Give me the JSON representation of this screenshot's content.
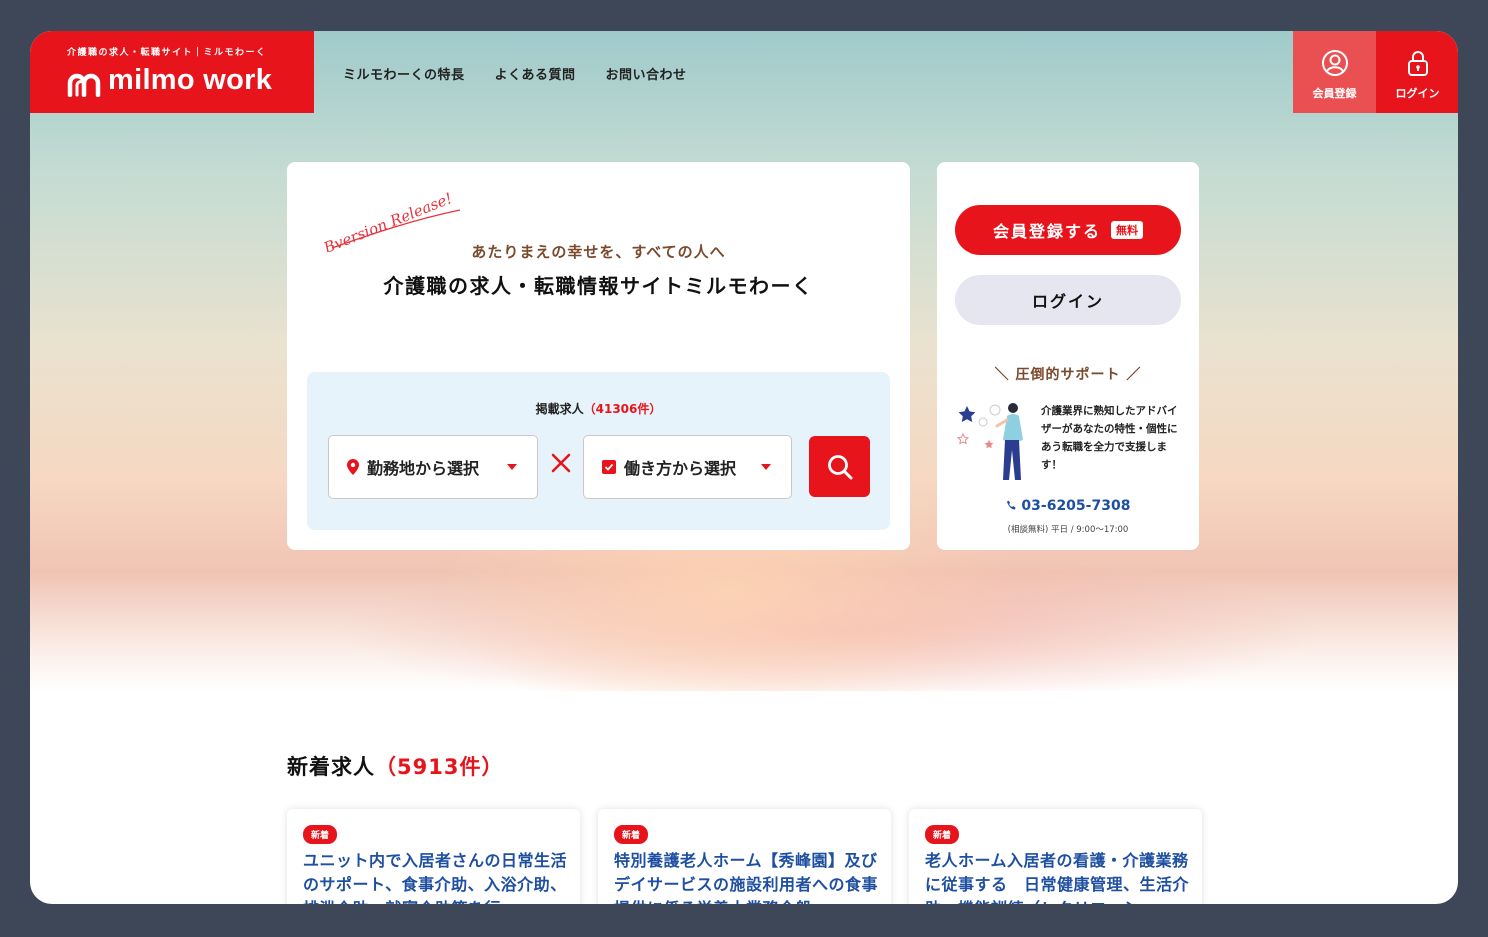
{
  "header": {
    "logo_tagline": "介護職の求人・転職サイト｜ミルモわーく",
    "logo_text": "milmo work",
    "nav": [
      {
        "label": "ミルモわーくの特長"
      },
      {
        "label": "よくある質問"
      },
      {
        "label": "お問い合わせ"
      }
    ],
    "register_label": "会員登録",
    "login_label": "ログイン"
  },
  "hero": {
    "release_badge": "Bversion Release!",
    "tagline": "あたりまえの幸せを、すべての人へ",
    "title": "介護職の求人・転職情報サイトミルモわーく",
    "listing_label": "掲載求人",
    "listing_count": "（41306件）",
    "area_select": "勤務地から選択",
    "work_select": "働き方から選択"
  },
  "side": {
    "register_button": "会員登録する",
    "free_badge": "無料",
    "login_button": "ログイン",
    "support_title": "＼ 圧倒的サポート ／",
    "support_text": "介護業界に熟知したアドバイザーがあなたの特性・個性にあう転職を全力で支援します！",
    "phone": "03-6205-7308",
    "hours": "(相談無料) 平日 / 9:00〜17:00"
  },
  "new_jobs": {
    "title": "新着求人",
    "count": "（5913件）",
    "items": [
      {
        "badge": "新着",
        "title": "ユニット内で入居者さんの日常生活のサポート、食事介助、入浴介助、排泄介助、就寝介助等を行"
      },
      {
        "badge": "新着",
        "title": "特別養護老人ホーム【秀峰園】及びデイサービスの施設利用者への食事提供に係る栄養士業務全般"
      },
      {
        "badge": "新着",
        "title": "老人ホーム入居者の看護・介護業務に従事する　日常健康管理、生活介助、機能訓練（レクリエーシ"
      }
    ]
  },
  "colors": {
    "brand": "#e8141c",
    "link": "#1e4fa0",
    "accent_brown": "#7a4a2e"
  }
}
